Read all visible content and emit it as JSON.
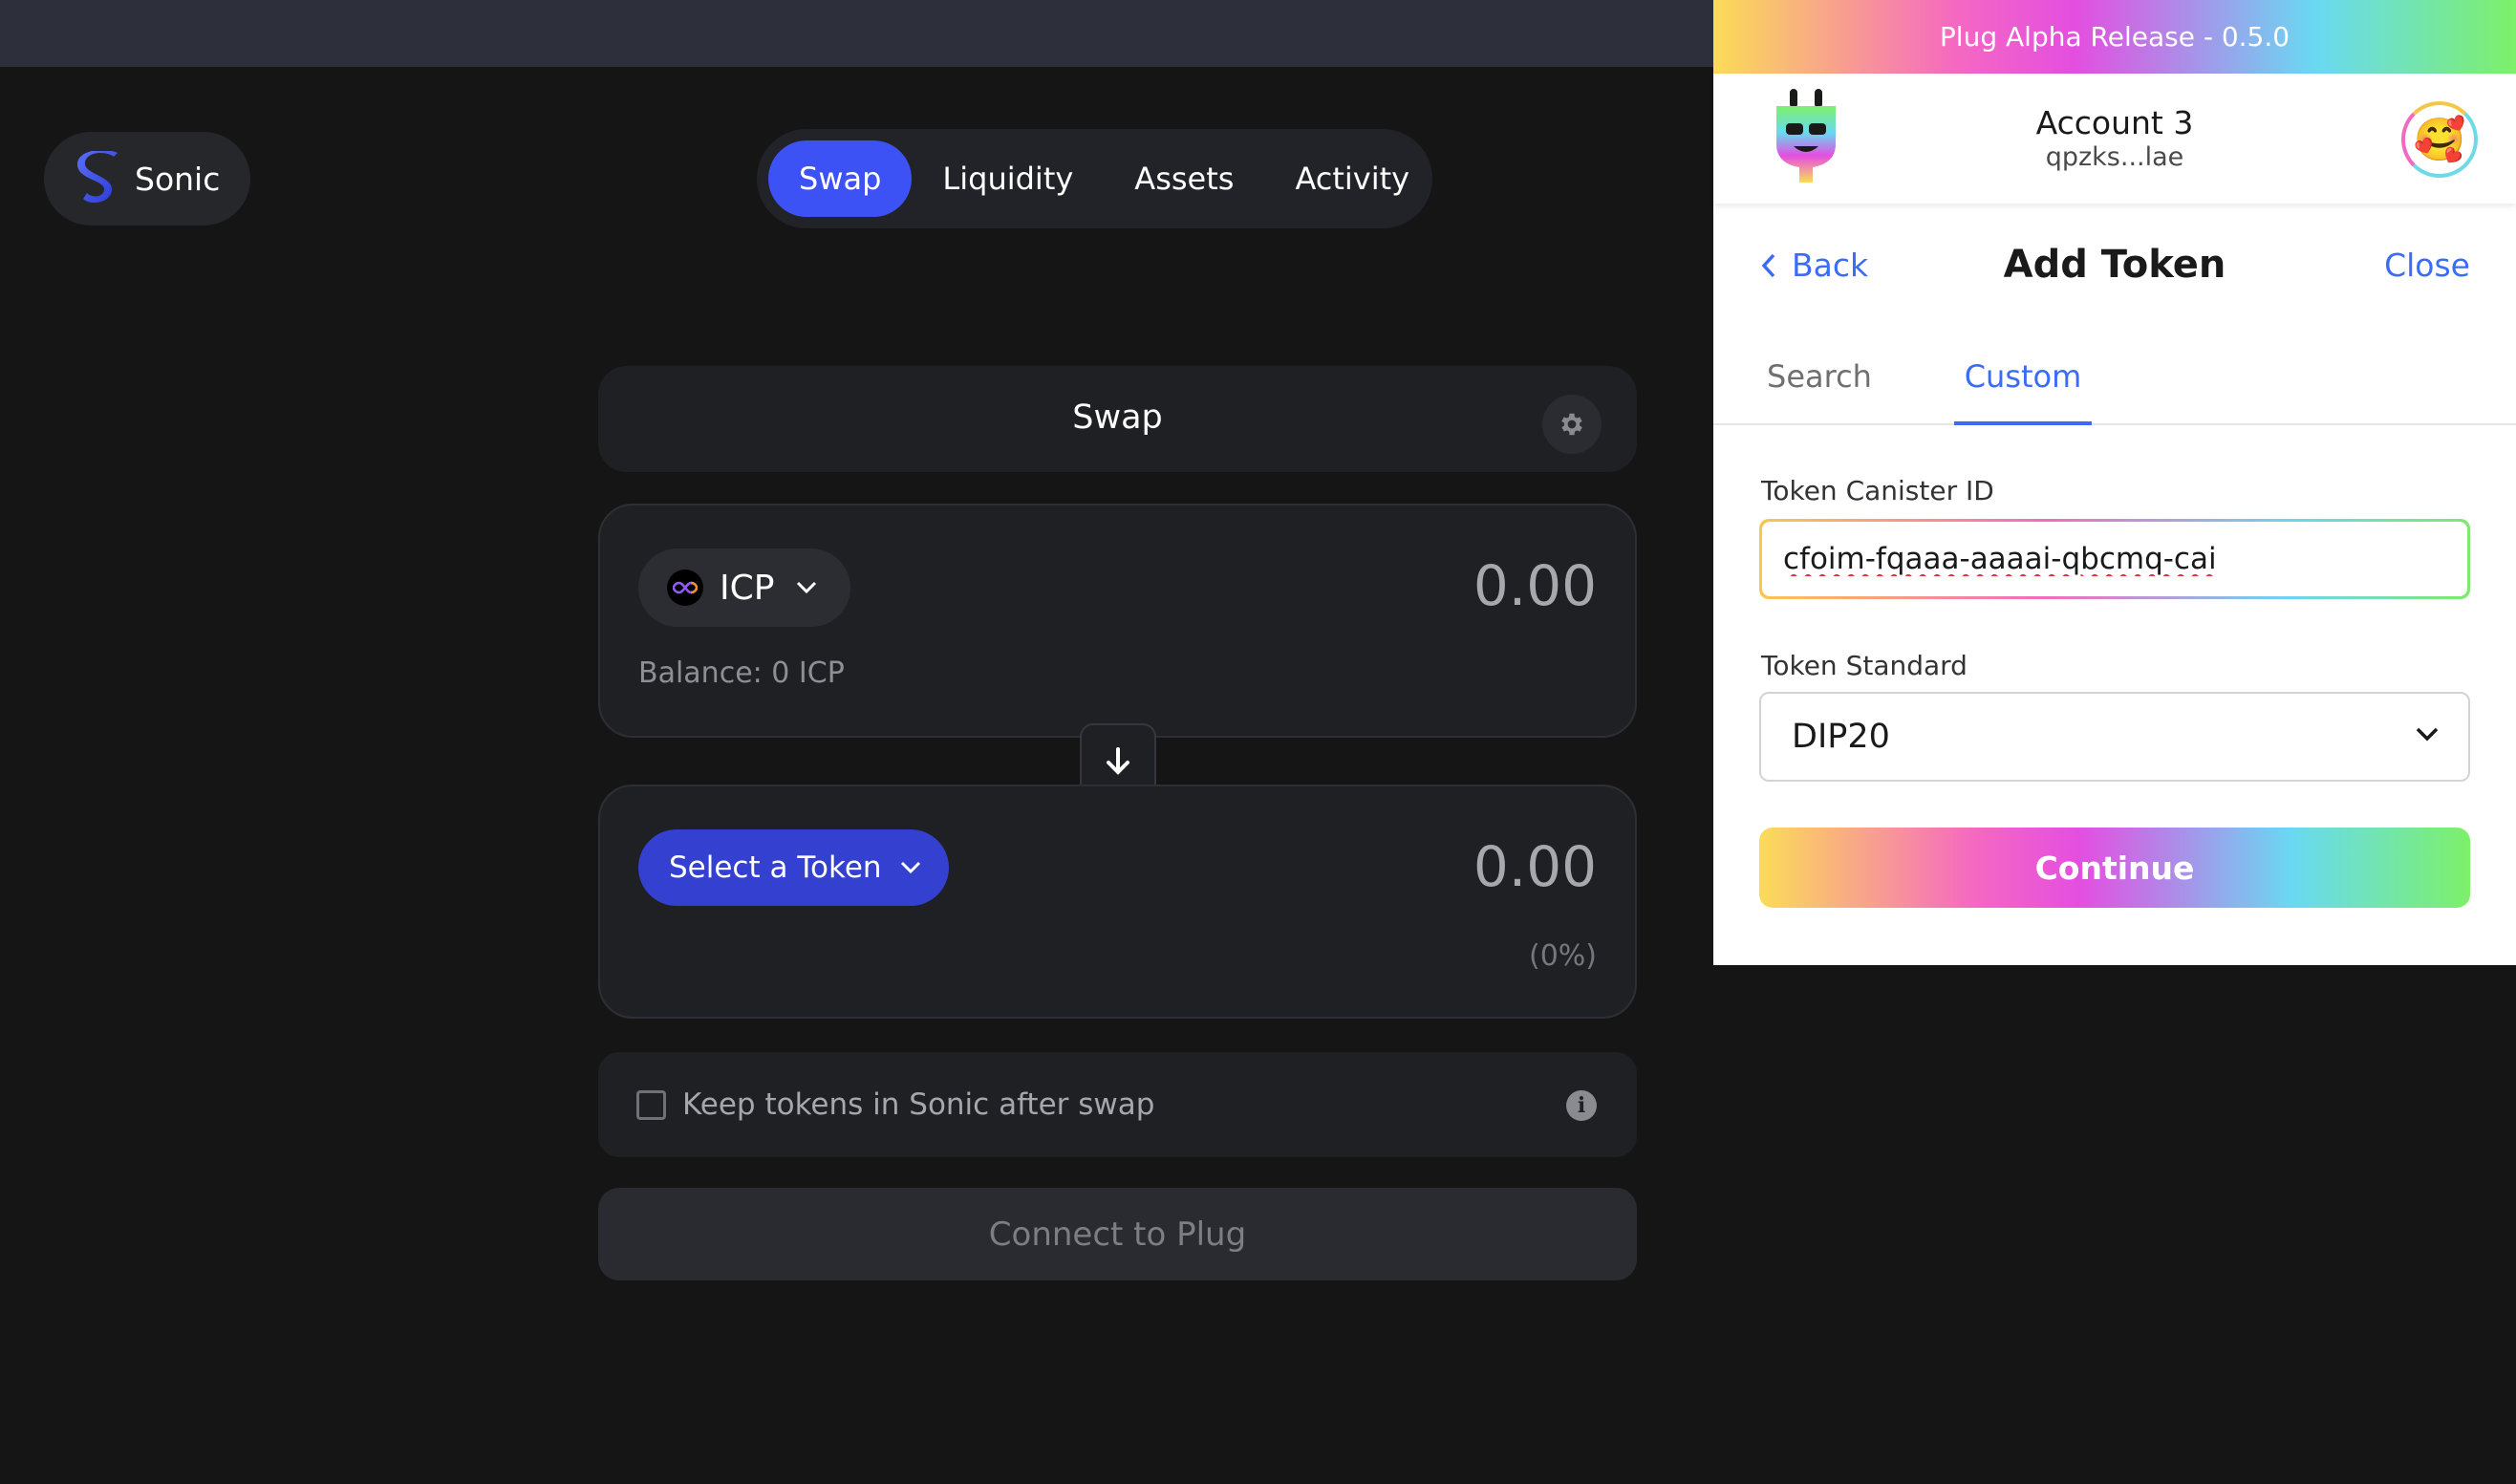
{
  "app": {
    "logo_text": "Sonic",
    "nav": [
      {
        "label": "Swap",
        "active": true
      },
      {
        "label": "Liquidity",
        "active": false
      },
      {
        "label": "Assets",
        "active": false
      },
      {
        "label": "Activity",
        "active": false
      }
    ],
    "swap_title": "Swap",
    "from": {
      "token": "ICP",
      "amount": "0.00",
      "balance": "Balance: 0 ICP"
    },
    "to": {
      "select_label": "Select a Token",
      "amount": "0.00",
      "percent": "(0%)"
    },
    "keep_tokens_label": "Keep tokens in Sonic after swap",
    "keep_tokens_checked": false,
    "connect_label": "Connect to Plug",
    "icons": [
      "sonic-logo-icon",
      "gear-icon",
      "icp-token-icon",
      "chevron-down-icon",
      "arrow-down-icon",
      "info-icon"
    ]
  },
  "plug": {
    "banner": "Plug Alpha Release - 0.5.0",
    "account_name": "Account 3",
    "account_address": "qpzks...lae",
    "avatar_emoji": "🥰",
    "back_label": "Back",
    "title": "Add Token",
    "close_label": "Close",
    "tabs": [
      {
        "label": "Search",
        "active": false
      },
      {
        "label": "Custom",
        "active": true
      }
    ],
    "canister_label": "Token Canister ID",
    "canister_value": "cfoim-fqaaa-aaaai-qbcmq-cai",
    "standard_label": "Token Standard",
    "standard_value": "DIP20",
    "continue_label": "Continue",
    "colors": {
      "link": "#3b6cf6",
      "gradient": [
        "#fbdc57",
        "#f569c1",
        "#e44ee0",
        "#69d9f2",
        "#7df06a"
      ]
    }
  },
  "colors": {
    "background": "#151515",
    "accent": "#3d52f4",
    "select_token": "#3440d0"
  }
}
